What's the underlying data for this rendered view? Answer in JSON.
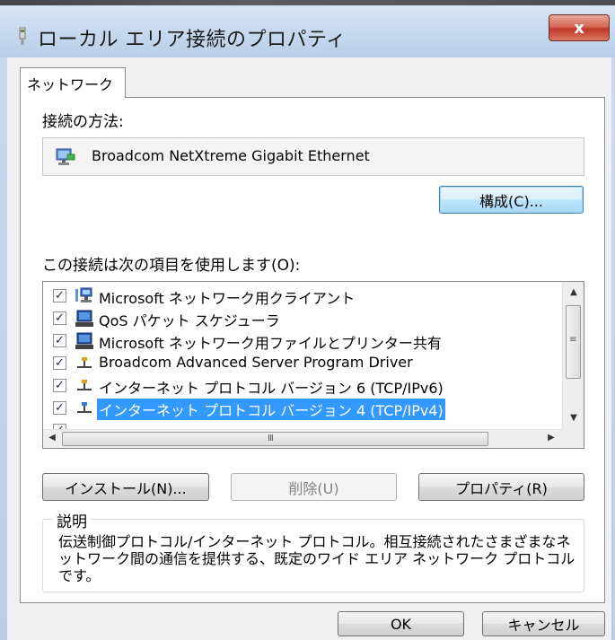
{
  "window": {
    "title": "ローカル エリア接続のプロパティ",
    "close_label": "x"
  },
  "tabs": [
    {
      "label": "ネットワーク"
    }
  ],
  "connect_using": {
    "label": "接続の方法:",
    "adapter_name": "Broadcom NetXtreme Gigabit Ethernet",
    "configure_button": "構成(C)..."
  },
  "items_section": {
    "label": "この接続は次の項目を使用します(O):",
    "items": [
      {
        "label": "Microsoft ネットワーク用クライアント",
        "checked": true,
        "icon": "network-client-icon",
        "selected": false
      },
      {
        "label": "QoS パケット スケジューラ",
        "checked": true,
        "icon": "computer-icon",
        "selected": false
      },
      {
        "label": "Microsoft ネットワーク用ファイルとプリンター共有",
        "checked": true,
        "icon": "computer-icon",
        "selected": false
      },
      {
        "label": "Broadcom Advanced Server Program Driver",
        "checked": true,
        "icon": "protocol-icon",
        "selected": false
      },
      {
        "label": "インターネット プロトコル バージョン 6 (TCP/IPv6)",
        "checked": true,
        "icon": "protocol-icon",
        "selected": false
      },
      {
        "label": "インターネット プロトコル バージョン 4 (TCP/IPv4)",
        "checked": true,
        "icon": "protocol-icon",
        "selected": true
      }
    ],
    "scroll_grip": "III"
  },
  "buttons": {
    "install": "インストール(N)...",
    "uninstall": "削除(U)",
    "properties": "プロパティ(R)",
    "ok": "OK",
    "cancel": "キャンセル"
  },
  "description": {
    "title": "説明",
    "text": "伝送制御プロトコル/インターネット プロトコル。相互接続されたさまざまなネットワーク間の通信を提供する、既定のワイド エリア ネットワーク プロトコルです。"
  },
  "colors": {
    "selection": "#3399ff",
    "dialog_bg": "#f0f0f0",
    "close_button": "#c0392b"
  }
}
